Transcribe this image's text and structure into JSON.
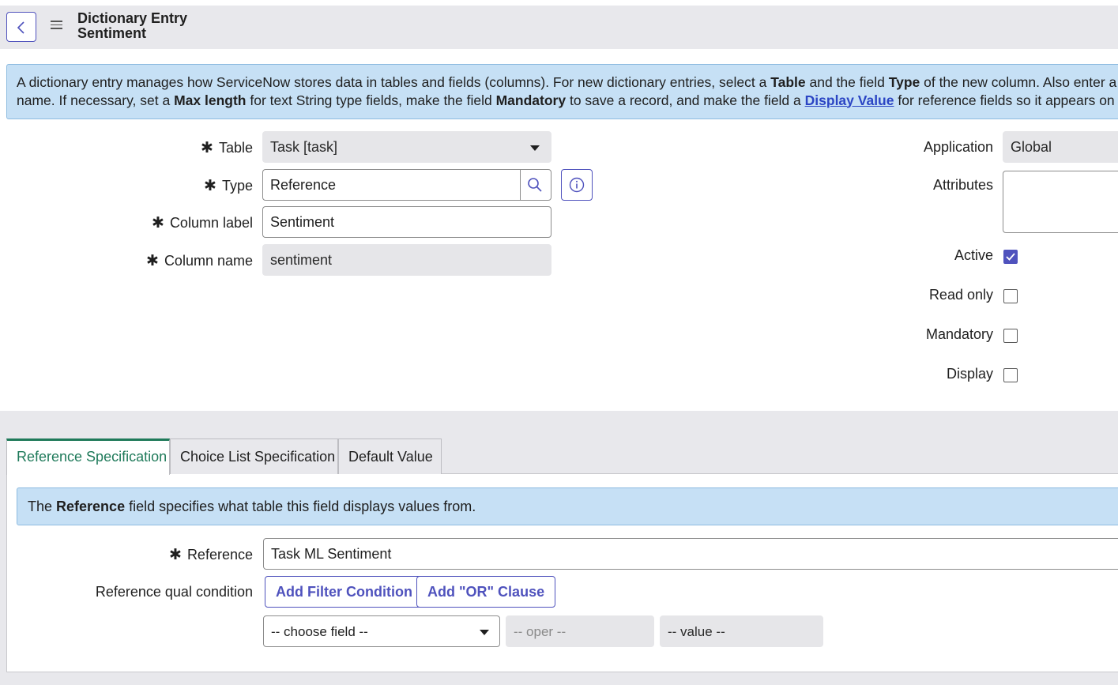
{
  "header": {
    "title_line1": "Dictionary Entry",
    "title_line2": "Sentiment"
  },
  "info_banner": {
    "p1": "A dictionary entry manages how ServiceNow stores data in tables and fields (columns). For new dictionary entries, select a ",
    "b1": "Table",
    "p2": " and the field ",
    "b2": "Type",
    "p3": " of the new column. Also enter a colum",
    "p4": "name. If necessary, set a ",
    "b3": "Max length",
    "p5": " for text String type fields, make the field ",
    "b4": "Mandatory",
    "p6": " to save a record, and make the field a ",
    "link": "Display Value",
    "p7": " for reference fields so it appears on records"
  },
  "form": {
    "table_label": "Table",
    "table_value": "Task [task]",
    "type_label": "Type",
    "type_value": "Reference",
    "column_label_label": "Column label",
    "column_label_value": "Sentiment",
    "column_name_label": "Column name",
    "column_name_value": "sentiment",
    "application_label": "Application",
    "application_value": "Global",
    "attributes_label": "Attributes",
    "attributes_value": "",
    "active_label": "Active",
    "active_checked": true,
    "read_only_label": "Read only",
    "read_only_checked": false,
    "mandatory_label": "Mandatory",
    "mandatory_checked": false,
    "display_label": "Display",
    "display_checked": false
  },
  "tabs": [
    {
      "label": "Reference Specification",
      "active": true
    },
    {
      "label": "Choice List Specification",
      "active": false
    },
    {
      "label": "Default Value",
      "active": false
    }
  ],
  "reference_section": {
    "info_pre": "The ",
    "info_bold": "Reference",
    "info_post": " field specifies what table this field displays values from.",
    "reference_label": "Reference",
    "reference_value": "Task ML Sentiment",
    "qual_label": "Reference qual condition",
    "add_filter_label": "Add Filter Condition",
    "add_or_label": "Add \"OR\" Clause",
    "choose_field": "-- choose field --",
    "oper": "-- oper --",
    "value": "-- value --"
  },
  "colors": {
    "accent": "#4f52bd",
    "active_tab": "#1f7a5a",
    "info_bg": "#c6e0f5"
  }
}
